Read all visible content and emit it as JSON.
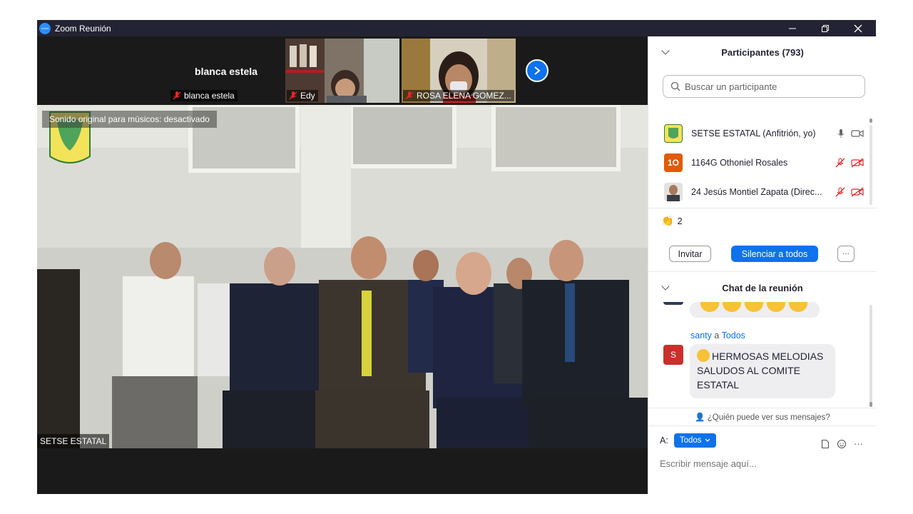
{
  "window": {
    "title": "Zoom Reunión",
    "controls": [
      "minimize",
      "restore",
      "close"
    ]
  },
  "video_strip": {
    "tiles": [
      {
        "name_display": "blanca estela",
        "label": "blanca estela",
        "muted": true
      },
      {
        "label": "Edy",
        "muted": true
      },
      {
        "label": "ROSA ELENA GOMEZ...",
        "muted": true
      }
    ],
    "next_icon": "chevron-right-icon"
  },
  "main_video": {
    "sound_banner": "Sonido original para músicos: desactivado",
    "speaker_label": "SETSE ESTATAL"
  },
  "participants": {
    "header": "Participantes (793)",
    "search_placeholder": "Buscar un participante",
    "list": [
      {
        "name": "SETSE ESTATAL (Anfitrión, yo)",
        "mic": "on",
        "video": "on",
        "avatar_type": "logo"
      },
      {
        "name": "1164G Othoniel Rosales",
        "avatar_text": "1O",
        "avatar_color": "#e15a06",
        "mic": "off",
        "video": "off"
      },
      {
        "name": "24 Jesús Montiel Zapata (Direc...",
        "mic": "off",
        "video": "off",
        "avatar_type": "photo"
      }
    ],
    "reaction_count": "2",
    "invite_label": "Invitar",
    "mute_all_label": "Silenciar a todos",
    "more_label": "···"
  },
  "chat": {
    "header": "Chat de la reunión",
    "messages": [
      {
        "sender": "santy",
        "to_word": "a",
        "to": "Todos",
        "avatar_text": "S",
        "text": "HERMOSAS  MELODIAS SALUDOS AL COMITE ESTATAL"
      }
    ],
    "visibility_note": "¿Quién puede ver sus mensajes?",
    "to_label": "A:",
    "to_button": "Todos",
    "input_placeholder": "Escribir mensaje aquí..."
  },
  "colors": {
    "accent": "#0e72ed",
    "mute_red": "#e02828",
    "titlebar": "#232333"
  }
}
